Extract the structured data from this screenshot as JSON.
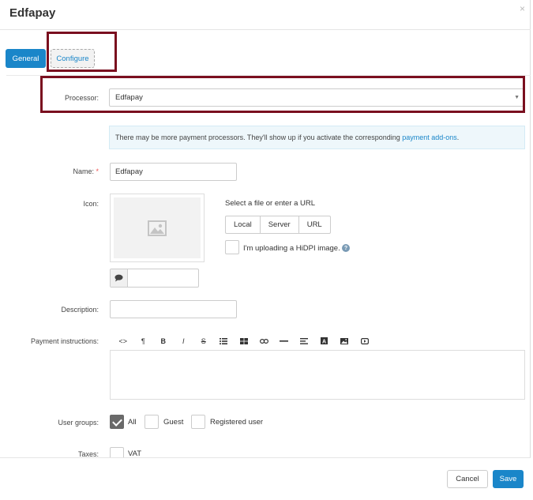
{
  "dialog": {
    "title": "Edfapay",
    "close_glyph": "×"
  },
  "tabs": [
    {
      "label": "General",
      "active": true
    },
    {
      "label": "Configure",
      "active": false
    }
  ],
  "processor": {
    "label": "Processor:",
    "value": "Edfapay"
  },
  "info": {
    "text": "There may be more payment processors. They'll show up if you activate the corresponding",
    "link": "payment add-ons",
    "suffix": "."
  },
  "name": {
    "label": "Name:",
    "required_mark": "*",
    "value": "Edfapay"
  },
  "icon": {
    "label": "Icon:",
    "placeholder_icon": "image-placeholder-icon",
    "select_text": "Select a file or enter a URL",
    "sources": [
      "Local",
      "Server",
      "URL"
    ],
    "hidpi_label": "I'm uploading a HiDPI image.",
    "help_glyph": "?",
    "alt_value": ""
  },
  "description": {
    "label": "Description:",
    "value": ""
  },
  "payment_instructions": {
    "label": "Payment instructions:",
    "toolbar": [
      "code-icon",
      "paragraph-icon",
      "bold-icon",
      "italic-icon",
      "strikethrough-icon",
      "unordered-list-icon",
      "table-icon",
      "link-icon",
      "horizontal-rule-icon",
      "align-icon",
      "text-color-icon",
      "image-icon",
      "video-icon"
    ]
  },
  "user_groups": {
    "label": "User groups:",
    "options": [
      {
        "label": "All",
        "checked": true
      },
      {
        "label": "Guest",
        "checked": false
      },
      {
        "label": "Registered user",
        "checked": false
      }
    ]
  },
  "taxes": {
    "label": "Taxes:",
    "options": [
      {
        "label": "VAT",
        "checked": false
      }
    ]
  },
  "footer": {
    "cancel_label": "Cancel",
    "save_label": "Save"
  },
  "colors": {
    "primary": "#1a86c9",
    "highlight": "#7a0f1f"
  }
}
